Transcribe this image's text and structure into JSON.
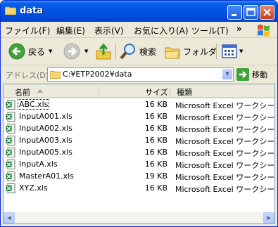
{
  "window": {
    "title": "data"
  },
  "menu": [
    {
      "label": "ファイル(F)"
    },
    {
      "label": "編集(E)"
    },
    {
      "label": "表示(V)"
    },
    {
      "label": "お気に入り(A)"
    },
    {
      "label": "ツール(T)"
    }
  ],
  "menu_more": "»",
  "toolbar": {
    "back_label": "戻る",
    "search_label": "検索",
    "folders_label": "フォルダ"
  },
  "address": {
    "label": "アドレス(D)",
    "value": "C:¥ETP2002¥data",
    "go_label": "移動"
  },
  "columns": {
    "name": "名前",
    "size": "サイズ",
    "type": "種類"
  },
  "files": [
    {
      "name": "ABC.xls",
      "size": "16 KB",
      "type": "Microsoft Excel ワークシート"
    },
    {
      "name": "InputA001.xls",
      "size": "16 KB",
      "type": "Microsoft Excel ワークシート"
    },
    {
      "name": "InputA002.xls",
      "size": "16 KB",
      "type": "Microsoft Excel ワークシート"
    },
    {
      "name": "InputA003.xls",
      "size": "16 KB",
      "type": "Microsoft Excel ワークシート"
    },
    {
      "name": "InputA005.xls",
      "size": "16 KB",
      "type": "Microsoft Excel ワークシート"
    },
    {
      "name": "InputA.xls",
      "size": "16 KB",
      "type": "Microsoft Excel ワークシート"
    },
    {
      "name": "MasterA01.xls",
      "size": "19 KB",
      "type": "Microsoft Excel ワークシート"
    },
    {
      "name": "XYZ.xls",
      "size": "16 KB",
      "type": "Microsoft Excel ワークシート"
    }
  ],
  "colors": {
    "titlebar": "#0054e3",
    "accent": "#0831d9"
  }
}
